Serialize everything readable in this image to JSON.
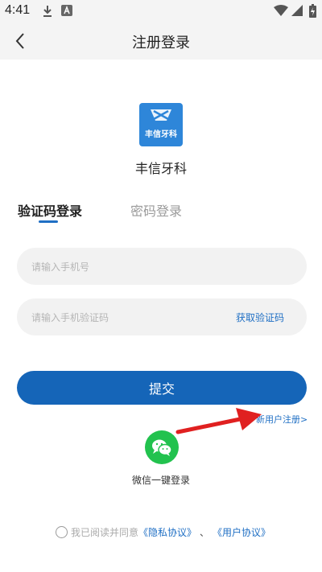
{
  "status_bar": {
    "time": "4:41"
  },
  "header": {
    "title": "注册登录"
  },
  "app": {
    "name": "丰信牙科",
    "logo_text": "丰信牙科"
  },
  "tabs": [
    {
      "label": "验证码登录",
      "active": true
    },
    {
      "label": "密码登录",
      "active": false
    }
  ],
  "form": {
    "phone_placeholder": "请输入手机号",
    "code_placeholder": "请输入手机验证码",
    "get_code_label": "获取验证码",
    "submit_label": "提交"
  },
  "register": {
    "label": "新用户注册>"
  },
  "wechat": {
    "label": "微信一键登录"
  },
  "agreement": {
    "prefix": "我已阅读并同意",
    "privacy": "《隐私协议》",
    "separator": "、",
    "user": "《用户协议》"
  },
  "colors": {
    "accent": "#1565b8",
    "link": "#1f6fc4",
    "wechat": "#22c24e",
    "annotation_arrow": "#e02020"
  },
  "icons": [
    "download-icon",
    "font-icon",
    "wifi-icon",
    "signal-icon",
    "battery-icon",
    "back-icon",
    "wechat-icon"
  ]
}
